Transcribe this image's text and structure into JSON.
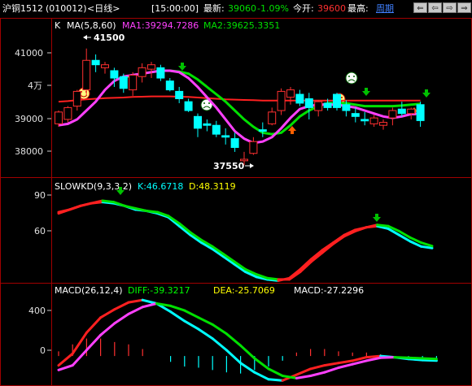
{
  "topbar": {
    "symbol": "沪铜1512",
    "code": "(010012)",
    "period": "<日线>",
    "time": "[15:00:00]",
    "last_label": "最新:",
    "last_value": "39060",
    "change": "-1.09%",
    "open_label": "今开:",
    "open_value": "39600",
    "high_label": "最高:",
    "weekly_link": "周期",
    "colors": {
      "text": "#ffffff",
      "down": "#00e000",
      "up": "#ff3030",
      "link": "#4080ff"
    },
    "buttons": [
      {
        "icon": "back-icon",
        "glyph": "⇐"
      },
      {
        "icon": "left-icon",
        "glyph": "⇦"
      },
      {
        "icon": "right-icon",
        "glyph": "⇨"
      },
      {
        "icon": "forward-icon",
        "glyph": "⇒"
      }
    ]
  },
  "panels": {
    "price": {
      "header_k": "K",
      "header_ma": "MA(5,8,60)",
      "ma1_text": "MA1:39294.7286",
      "ma2_text": "MA2:39625.3351",
      "y_ticks": [
        "41000",
        "4万",
        "39000",
        "38000"
      ],
      "high_marker": "41500",
      "low_marker": "37550"
    },
    "kd": {
      "header": "SLOWKD(9,3,3,2)",
      "k_text": "K:46.6718",
      "d_text": "D:48.3119",
      "y_ticks": [
        "90",
        "60"
      ]
    },
    "macd": {
      "header": "MACD(26,12,4)",
      "diff_text": "DIFF:-39.3217",
      "dea_text": "DEA:-25.7069",
      "macd_text": "MACD:-27.2296",
      "y_ticks": [
        "400",
        "0"
      ]
    }
  },
  "chart_data": [
    {
      "type": "candlestick",
      "title": "K MA(5,8,60)",
      "ylim": [
        37200,
        42400
      ],
      "candles": [
        {
          "o": 38950,
          "h": 39400,
          "l": 38850,
          "c": 39350
        },
        {
          "o": 39100,
          "h": 39550,
          "l": 39000,
          "c": 39500
        },
        {
          "o": 39550,
          "h": 40100,
          "l": 39400,
          "c": 40050
        },
        {
          "o": 40100,
          "h": 41500,
          "l": 39900,
          "c": 41100
        },
        {
          "o": 41100,
          "h": 41300,
          "l": 40700,
          "c": 40950
        },
        {
          "o": 40850,
          "h": 41050,
          "l": 40650,
          "c": 40950
        },
        {
          "o": 40750,
          "h": 40850,
          "l": 40200,
          "c": 40500
        },
        {
          "o": 40550,
          "h": 40650,
          "l": 40000,
          "c": 40150
        },
        {
          "o": 40100,
          "h": 40700,
          "l": 39900,
          "c": 40600
        },
        {
          "o": 40550,
          "h": 41000,
          "l": 40350,
          "c": 40850
        },
        {
          "o": 40800,
          "h": 41050,
          "l": 40500,
          "c": 40950
        },
        {
          "o": 40850,
          "h": 40950,
          "l": 40400,
          "c": 40500
        },
        {
          "o": 40400,
          "h": 40500,
          "l": 40050,
          "c": 40100
        },
        {
          "o": 40050,
          "h": 40200,
          "l": 39650,
          "c": 39800
        },
        {
          "o": 39700,
          "h": 39800,
          "l": 39350,
          "c": 39400
        },
        {
          "o": 39200,
          "h": 39300,
          "l": 38500,
          "c": 38800
        },
        {
          "o": 38950,
          "h": 39100,
          "l": 38700,
          "c": 38900
        },
        {
          "o": 38900,
          "h": 39050,
          "l": 38500,
          "c": 38600
        },
        {
          "o": 38550,
          "h": 38800,
          "l": 38250,
          "c": 38500
        },
        {
          "o": 38450,
          "h": 38650,
          "l": 38000,
          "c": 38150
        },
        {
          "o": 37700,
          "h": 38000,
          "l": 37550,
          "c": 37750
        },
        {
          "o": 37950,
          "h": 38500,
          "l": 37900,
          "c": 38350
        },
        {
          "o": 38750,
          "h": 39000,
          "l": 38500,
          "c": 38700
        },
        {
          "o": 38950,
          "h": 39500,
          "l": 38900,
          "c": 39350
        },
        {
          "o": 39400,
          "h": 40150,
          "l": 39250,
          "c": 40050
        },
        {
          "o": 39850,
          "h": 40200,
          "l": 39600,
          "c": 40100
        },
        {
          "o": 39950,
          "h": 40100,
          "l": 39550,
          "c": 39650
        },
        {
          "o": 39800,
          "h": 40000,
          "l": 39100,
          "c": 39500
        },
        {
          "o": 39400,
          "h": 39750,
          "l": 39200,
          "c": 39700
        },
        {
          "o": 39650,
          "h": 39800,
          "l": 39400,
          "c": 39500
        },
        {
          "o": 39950,
          "h": 40000,
          "l": 39400,
          "c": 39500
        },
        {
          "o": 39600,
          "h": 39750,
          "l": 39200,
          "c": 39400
        },
        {
          "o": 39300,
          "h": 39500,
          "l": 39000,
          "c": 39200
        },
        {
          "o": 39100,
          "h": 39350,
          "l": 38900,
          "c": 39050
        },
        {
          "o": 38950,
          "h": 39250,
          "l": 38850,
          "c": 39150
        },
        {
          "o": 38900,
          "h": 39100,
          "l": 38750,
          "c": 39000
        },
        {
          "o": 39150,
          "h": 39500,
          "l": 38900,
          "c": 39400
        },
        {
          "o": 39450,
          "h": 39700,
          "l": 39200,
          "c": 39300
        },
        {
          "o": 39300,
          "h": 39500,
          "l": 39100,
          "c": 39450
        },
        {
          "o": 39600,
          "h": 39700,
          "l": 38850,
          "c": 39060
        }
      ],
      "series": [
        {
          "name": "MA1",
          "values": [
            38900,
            38950,
            39100,
            39400,
            39700,
            40100,
            40400,
            40550,
            40600,
            40650,
            40700,
            40750,
            40750,
            40700,
            40500,
            40200,
            39850,
            39500,
            39100,
            38700,
            38450,
            38300,
            38350,
            38500,
            38800,
            39150,
            39450,
            39550,
            39600,
            39600,
            39600,
            39550,
            39500,
            39400,
            39300,
            39200,
            39150,
            39200,
            39280,
            39294.73
          ]
        },
        {
          "name": "MA2",
          "values": [
            null,
            null,
            null,
            null,
            null,
            null,
            null,
            40500,
            40600,
            40650,
            40700,
            40750,
            40750,
            40720,
            40650,
            40450,
            40200,
            39950,
            39700,
            39400,
            39100,
            38850,
            38650,
            38600,
            38650,
            38900,
            39200,
            39400,
            39550,
            39650,
            39650,
            39650,
            39600,
            39550,
            39550,
            39550,
            39550,
            39570,
            39600,
            39625.34
          ]
        },
        {
          "name": "MA3",
          "values": [
            39700,
            39720,
            39750,
            39780,
            39800,
            39820,
            39830,
            39840,
            39860,
            39870,
            39880,
            39880,
            39880,
            39870,
            39860,
            39840,
            39820,
            39800,
            39780,
            39770,
            39760,
            39750,
            39740,
            39740,
            39740,
            39740,
            39740,
            39740,
            39740,
            39740,
            39740,
            39740,
            39740,
            39740,
            39740,
            39740,
            39740,
            39740,
            39740,
            39740
          ]
        }
      ]
    },
    {
      "type": "line",
      "title": "SLOWKD(9,3,3,2)",
      "ylim": [
        20,
        100
      ],
      "series": [
        {
          "name": "K",
          "values": [
            75,
            77,
            80,
            82,
            83,
            82,
            80,
            77,
            76,
            74,
            71,
            64,
            57,
            51,
            46,
            40,
            34,
            28,
            24,
            22,
            21,
            23,
            30,
            38,
            45,
            51,
            57,
            61,
            63,
            64,
            62,
            57,
            52,
            48,
            46.67
          ]
        },
        {
          "name": "D",
          "values": [
            74,
            77,
            80,
            82,
            84,
            83,
            80,
            78,
            76,
            75,
            72,
            66,
            59,
            53,
            48,
            42,
            36,
            30,
            26,
            23,
            22,
            22,
            28,
            36,
            43,
            50,
            56,
            60,
            63,
            65,
            64,
            60,
            55,
            51,
            48.31
          ]
        }
      ]
    },
    {
      "type": "line",
      "title": "MACD(26,12,4)",
      "ylim": [
        -250,
        600
      ],
      "series": [
        {
          "name": "DIFF",
          "values": [
            -80,
            20,
            200,
            330,
            400,
            460,
            480,
            450,
            380,
            300,
            230,
            150,
            50,
            -60,
            -140,
            -200,
            -210,
            -160,
            -110,
            -80,
            -60,
            -40,
            -10,
            0,
            -10,
            -25,
            -35,
            -39.32
          ]
        },
        {
          "name": "DEA",
          "values": [
            -120,
            -80,
            50,
            180,
            280,
            360,
            420,
            450,
            430,
            390,
            330,
            270,
            190,
            90,
            -20,
            -110,
            -170,
            -190,
            -170,
            -140,
            -100,
            -70,
            -40,
            -15,
            -10,
            -15,
            -20,
            -25.71
          ]
        },
        {
          "name": "MACD",
          "values": [
            40,
            100,
            150,
            150,
            120,
            100,
            60,
            0,
            -50,
            -90,
            -100,
            -120,
            -140,
            -150,
            -120,
            -90,
            -40,
            30,
            60,
            60,
            40,
            30,
            30,
            15,
            0,
            -10,
            -15,
            -27.23
          ]
        }
      ]
    }
  ]
}
